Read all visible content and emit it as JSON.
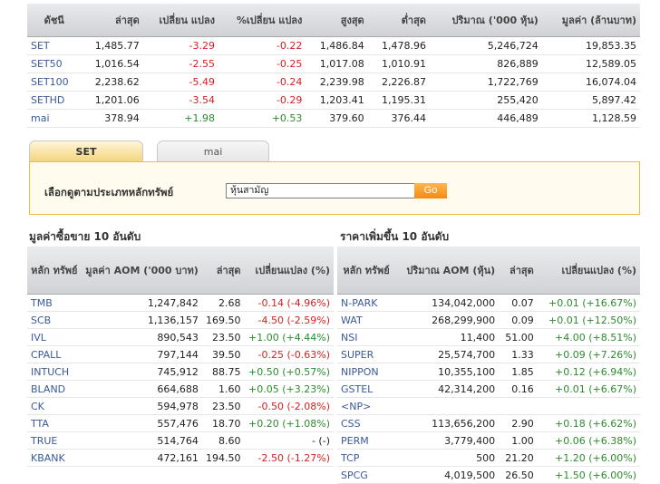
{
  "index_table": {
    "headers": [
      "ดัชนี",
      "ล่าสุด",
      "เปลี่ยน แปลง",
      "%เปลี่ยน แปลง",
      "สูงสุด",
      "ต่ำสุด",
      "ปริมาณ ('000 หุ้น)",
      "มูลค่า (ล้านบาท)"
    ],
    "rows": [
      {
        "name": "SET",
        "last": "1,485.77",
        "chg": "-3.29",
        "pct": "-0.22",
        "high": "1,486.84",
        "low": "1,478.96",
        "volume": "5,246,724",
        "value": "19,853.35",
        "dir": "neg"
      },
      {
        "name": "SET50",
        "last": "1,016.54",
        "chg": "-2.55",
        "pct": "-0.25",
        "high": "1,017.08",
        "low": "1,010.91",
        "volume": "826,889",
        "value": "12,589.05",
        "dir": "neg"
      },
      {
        "name": "SET100",
        "last": "2,238.62",
        "chg": "-5.49",
        "pct": "-0.24",
        "high": "2,239.98",
        "low": "2,226.87",
        "volume": "1,722,769",
        "value": "16,074.04",
        "dir": "neg"
      },
      {
        "name": "SETHD",
        "last": "1,201.06",
        "chg": "-3.54",
        "pct": "-0.29",
        "high": "1,203.41",
        "low": "1,195.31",
        "volume": "255,420",
        "value": "5,897.42",
        "dir": "neg"
      },
      {
        "name": "mai",
        "last": "378.94",
        "chg": "+1.98",
        "pct": "+0.53",
        "high": "379.60",
        "low": "376.44",
        "volume": "446,489",
        "value": "1,128.59",
        "dir": "pos"
      }
    ]
  },
  "tabs": {
    "set": "SET",
    "mai": "mai"
  },
  "filter": {
    "label": "เลือกดูตามประเภทหลักทรัพย์",
    "selected": "หุ้นสามัญ",
    "go": "Go"
  },
  "top_value": {
    "title": "มูลค่าซื้อขาย 10 อันดับ",
    "headers": [
      "หลัก ทรัพย์",
      "มูลค่า AOM ('000 บาท)",
      "ล่าสุด",
      "เปลี่ยนแปลง (%)"
    ],
    "rows": [
      {
        "sym": "TMB",
        "value": "1,247,842",
        "last": "2.68",
        "chg": "-0.14 (-4.96%)",
        "dir": "neg"
      },
      {
        "sym": "SCB",
        "value": "1,136,157",
        "last": "169.50",
        "chg": "-4.50 (-2.59%)",
        "dir": "neg"
      },
      {
        "sym": "IVL",
        "value": "890,543",
        "last": "23.50",
        "chg": "+1.00 (+4.44%)",
        "dir": "pos"
      },
      {
        "sym": "CPALL",
        "value": "797,144",
        "last": "39.50",
        "chg": "-0.25 (-0.63%)",
        "dir": "neg"
      },
      {
        "sym": "INTUCH",
        "value": "745,912",
        "last": "88.75",
        "chg": "+0.50 (+0.57%)",
        "dir": "pos"
      },
      {
        "sym": "BLAND",
        "value": "664,688",
        "last": "1.60",
        "chg": "+0.05 (+3.23%)",
        "dir": "pos"
      },
      {
        "sym": "CK",
        "value": "594,978",
        "last": "23.50",
        "chg": "-0.50 (-2.08%)",
        "dir": "neg"
      },
      {
        "sym": "TTA",
        "value": "557,476",
        "last": "18.70",
        "chg": "+0.20 (+1.08%)",
        "dir": "pos"
      },
      {
        "sym": "TRUE",
        "value": "514,764",
        "last": "8.60",
        "chg": "- (-)",
        "dir": "none"
      },
      {
        "sym": "KBANK",
        "value": "472,161",
        "last": "194.50",
        "chg": "-2.50 (-1.27%)",
        "dir": "neg"
      }
    ]
  },
  "top_gainers": {
    "title": "ราคาเพิ่มขึ้น 10 อันดับ",
    "headers": [
      "หลัก ทรัพย์",
      "ปริมาณ AOM (หุ้น)",
      "ล่าสุด",
      "เปลี่ยนแปลง (%)"
    ],
    "rows": [
      {
        "sym": "N-PARK",
        "volume": "134,042,000",
        "last": "0.07",
        "chg": "+0.01 (+16.67%)",
        "dir": "pos"
      },
      {
        "sym": "WAT",
        "volume": "268,299,900",
        "last": "0.09",
        "chg": "+0.01 (+12.50%)",
        "dir": "pos"
      },
      {
        "sym": "NSI",
        "volume": "11,400",
        "last": "51.00",
        "chg": "+4.00 (+8.51%)",
        "dir": "pos"
      },
      {
        "sym": "SUPER",
        "volume": "25,574,700",
        "last": "1.33",
        "chg": "+0.09 (+7.26%)",
        "dir": "pos"
      },
      {
        "sym": "NIPPON",
        "volume": "10,355,100",
        "last": "1.85",
        "chg": "+0.12 (+6.94%)",
        "dir": "pos"
      },
      {
        "sym": "GSTEL",
        "volume": "42,314,200",
        "last": "0.16",
        "chg": "+0.01 (+6.67%)",
        "dir": "pos"
      },
      {
        "sym": "<NP>",
        "volume": "",
        "last": "",
        "chg": "",
        "dir": "none"
      },
      {
        "sym": "CSS",
        "volume": "113,656,200",
        "last": "2.90",
        "chg": "+0.18 (+6.62%)",
        "dir": "pos"
      },
      {
        "sym": "PERM",
        "volume": "3,779,400",
        "last": "1.00",
        "chg": "+0.06 (+6.38%)",
        "dir": "pos"
      },
      {
        "sym": "TCP",
        "volume": "500",
        "last": "21.20",
        "chg": "+1.20 (+6.00%)",
        "dir": "pos"
      },
      {
        "sym": "SPCG",
        "volume": "4,019,500",
        "last": "26.50",
        "chg": "+1.50 (+6.00%)",
        "dir": "pos"
      }
    ]
  }
}
